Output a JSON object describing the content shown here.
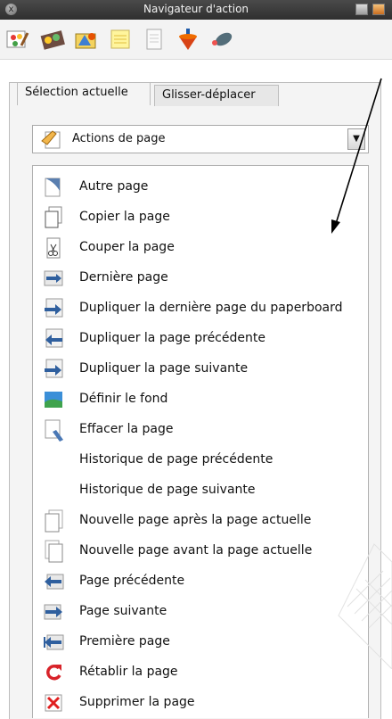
{
  "window": {
    "title": "Navigateur d'action",
    "close_glyph": "x"
  },
  "toolbar": {
    "icons": [
      "paint-palette-icon",
      "film-strip-icon",
      "shapes-icon",
      "note-icon",
      "document-icon",
      "spinning-top-icon",
      "eraser-icon"
    ]
  },
  "tabs": [
    {
      "label": "Sélection actuelle",
      "active": true
    },
    {
      "label": "Glisser-déplacer",
      "active": false
    }
  ],
  "dropdown": {
    "selected": "Actions de page",
    "arrow": "▼"
  },
  "actions": [
    {
      "label": "Autre page",
      "icon": "page-curl-icon"
    },
    {
      "label": "Copier la page",
      "icon": "copy-page-icon"
    },
    {
      "label": "Couper la page",
      "icon": "cut-page-icon"
    },
    {
      "label": "Dernière page",
      "icon": "last-page-icon"
    },
    {
      "label": "Dupliquer la dernière page du paperboard",
      "icon": "duplicate-last-icon"
    },
    {
      "label": "Dupliquer la page précédente",
      "icon": "duplicate-previous-icon"
    },
    {
      "label": "Dupliquer la page suivante",
      "icon": "duplicate-next-icon"
    },
    {
      "label": "Définir le fond",
      "icon": "background-icon"
    },
    {
      "label": "Effacer la page",
      "icon": "erase-page-icon"
    },
    {
      "label": "Historique de page précédente",
      "icon": ""
    },
    {
      "label": "Historique de page suivante",
      "icon": ""
    },
    {
      "label": "Nouvelle page après la page actuelle",
      "icon": "new-page-after-icon"
    },
    {
      "label": "Nouvelle page avant la page actuelle",
      "icon": "new-page-before-icon"
    },
    {
      "label": "Page précédente",
      "icon": "previous-page-icon"
    },
    {
      "label": "Page suivante",
      "icon": "next-page-icon"
    },
    {
      "label": "Première page",
      "icon": "first-page-icon"
    },
    {
      "label": "Rétablir la page",
      "icon": "reset-page-icon"
    },
    {
      "label": "Supprimer la page",
      "icon": "delete-page-icon"
    }
  ],
  "colors": {
    "title_bar": "#3a3a3a",
    "panel_bg": "#f4f4f4",
    "list_bg": "#ffffff",
    "arrow_icon_blue": "#2f5f9e",
    "reset_red": "#d8232a",
    "delete_red": "#e02020"
  }
}
